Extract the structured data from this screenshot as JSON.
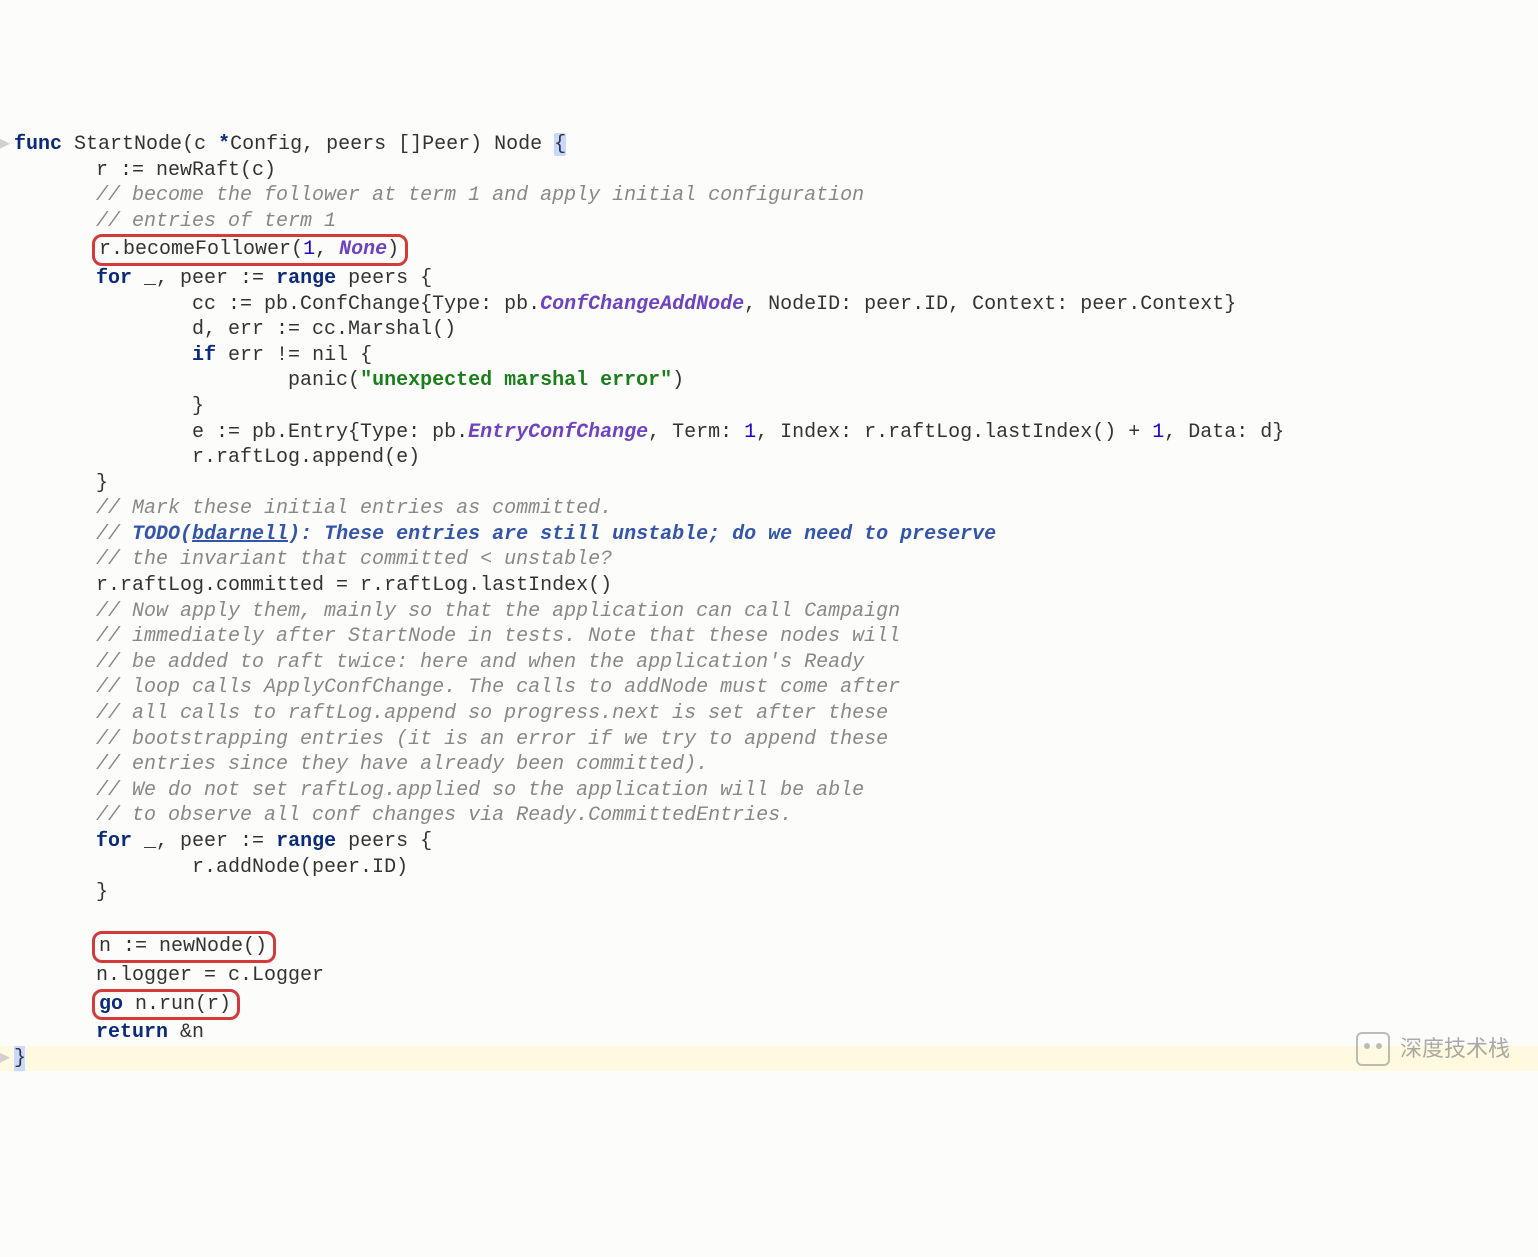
{
  "sig": {
    "func": "func",
    "name": "StartNode",
    "params_open": "(c ",
    "star": "*",
    "cfg": "Config, peers []Peer) Node ",
    "brace": "{"
  },
  "l2": "        r := newRaft(c)",
  "c3": "        // become the follower at term 1 and apply initial configuration",
  "c4": "        // entries of term 1",
  "l5a": "r.becomeFollower(",
  "l5n": "1",
  "l5b": ", ",
  "l5none": "None",
  "l5c": ")",
  "l6a": "        ",
  "l6for": "for",
  "l6b": " _, peer := ",
  "l6range": "range",
  "l6c": " peers {",
  "l7a": "                cc := pb.ConfChange{Type: pb.",
  "l7id": "ConfChangeAddNode",
  "l7b": ", NodeID: peer.ID, Context: peer.Context}",
  "l8": "                d, err := cc.Marshal()",
  "l9a": "                ",
  "l9if": "if",
  "l9b": " err != nil {",
  "l10a": "                        panic(",
  "l10s": "\"unexpected marshal error\"",
  "l10b": ")",
  "l11": "                }",
  "l12a": "                e := pb.Entry{Type: pb.",
  "l12id": "EntryConfChange",
  "l12b": ", Term: ",
  "l12n1": "1",
  "l12c": ", Index: r.raftLog.lastIndex() + ",
  "l12n2": "1",
  "l12d": ", Data: d}",
  "l13": "                r.raftLog.append(e)",
  "l14": "        }",
  "c15": "        // Mark these initial entries as committed.",
  "c16a": "        // ",
  "c16b": "TODO(",
  "c16u": "bdarnell",
  "c16c": "): These entries are still unstable; do we need to preserve",
  "c17": "        // the invariant that committed < unstable?",
  "l18": "        r.raftLog.committed = r.raftLog.lastIndex()",
  "c19": "        // Now apply them, mainly so that the application can call Campaign",
  "c20": "        // immediately after StartNode in tests. Note that these nodes will",
  "c21": "        // be added to raft twice: here and when the application's Ready",
  "c22": "        // loop calls ApplyConfChange. The calls to addNode must come after",
  "c23": "        // all calls to raftLog.append so progress.next is set after these",
  "c24": "        // bootstrapping entries (it is an error if we try to append these",
  "c25": "        // entries since they have already been committed).",
  "c26": "        // We do not set raftLog.applied so the application will be able",
  "c27": "        // to observe all conf changes via Ready.CommittedEntries.",
  "l28a": "        ",
  "l28for": "for",
  "l28b": " _, peer := ",
  "l28range": "range",
  "l28c": " peers {",
  "l29": "                r.addNode(peer.ID)",
  "l30": "        }",
  "blank": "",
  "l32box": "n := newNode()",
  "l33": "        n.logger = c.Logger",
  "l34a": "go",
  "l34b": " n.run(r)",
  "l35a": "        ",
  "l35ret": "return",
  "l35b": " &n",
  "l36": "}",
  "watermark": "深度技术栈"
}
